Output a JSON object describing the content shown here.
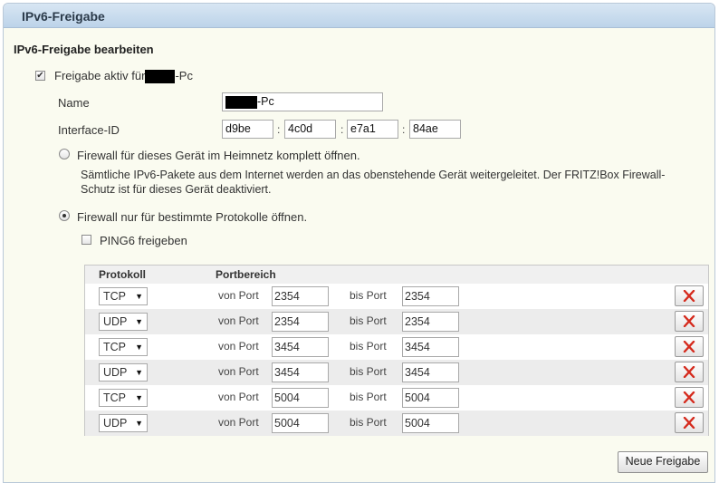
{
  "window": {
    "title": "IPv6-Freigabe"
  },
  "section_title": "IPv6-Freigabe bearbeiten",
  "active": {
    "label_prefix": "Freigabe aktiv für",
    "label_suffix": "-Pc",
    "checked": true
  },
  "name": {
    "label": "Name",
    "value_suffix": "-Pc"
  },
  "interface_id": {
    "label": "Interface-ID",
    "parts": [
      "d9be",
      "4c0d",
      "e7a1",
      "84ae"
    ],
    "separator": ":"
  },
  "firewall_open": {
    "label": "Firewall für dieses Gerät im Heimnetz komplett öffnen.",
    "description": "Sämtliche IPv6-Pakete aus dem Internet werden an das obenstehende Gerät weitergeleitet. Der FRITZ!Box Firewall-Schutz ist für dieses Gerät deaktiviert.",
    "selected": false
  },
  "firewall_protocols": {
    "label": "Firewall nur für bestimmte Protokolle öffnen.",
    "selected": true
  },
  "ping6": {
    "label": "PING6 freigeben",
    "checked": false
  },
  "table": {
    "headers": {
      "protocol": "Protokoll",
      "port_range": "Portbereich"
    },
    "from_label": "von Port",
    "to_label": "bis Port",
    "rows": [
      {
        "protocol": "TCP",
        "from": "2354",
        "to": "2354"
      },
      {
        "protocol": "UDP",
        "from": "2354",
        "to": "2354"
      },
      {
        "protocol": "TCP",
        "from": "3454",
        "to": "3454"
      },
      {
        "protocol": "UDP",
        "from": "3454",
        "to": "3454"
      },
      {
        "protocol": "TCP",
        "from": "5004",
        "to": "5004"
      },
      {
        "protocol": "UDP",
        "from": "5004",
        "to": "5004"
      }
    ]
  },
  "new_button": "Neue Freigabe",
  "colors": {
    "delete_x": "#d52b1e",
    "title_bar": "#c7dbee",
    "background": "#fafbf0"
  },
  "icons": {
    "delete": "close-icon",
    "dropdown": "chevron-down-icon",
    "check": "checkmark-icon"
  }
}
